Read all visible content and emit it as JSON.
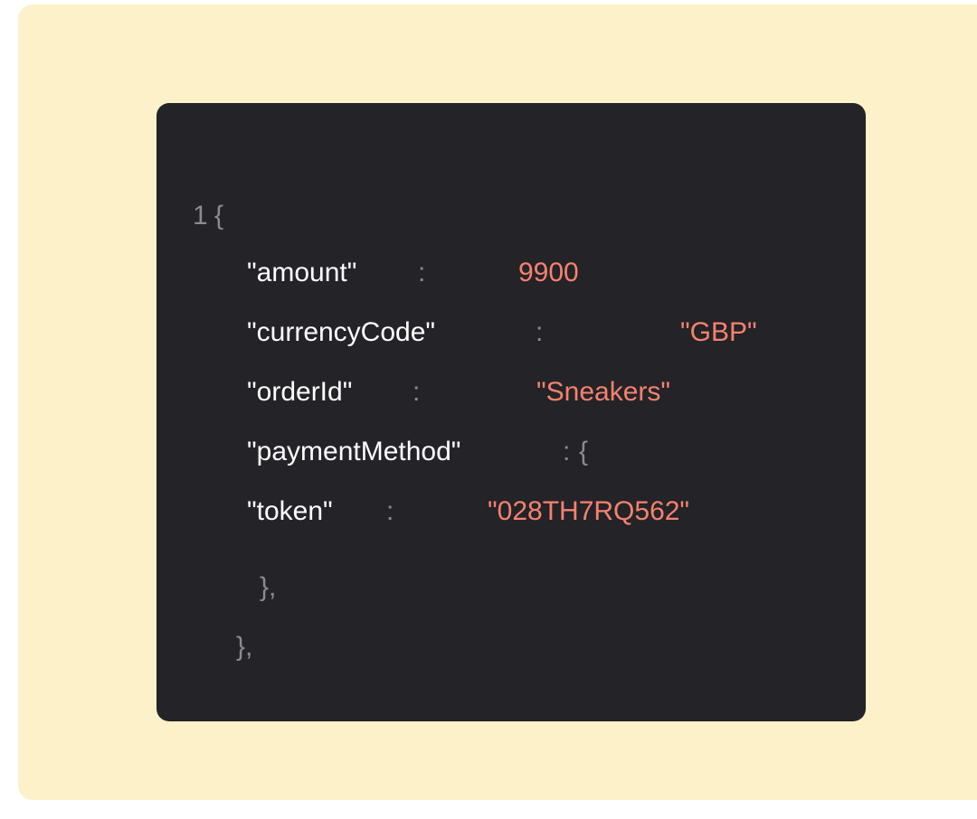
{
  "code": {
    "line_number": "1",
    "open_brace": "{",
    "colon": ":",
    "close_inner": "},",
    "close_outer": "},",
    "rows": [
      {
        "key": "\"amount\"",
        "value": "9900"
      },
      {
        "key": "\"currencyCode\"",
        "value": "\"GBP\""
      },
      {
        "key": "\"orderId\"",
        "value": "\"Sneakers\""
      },
      {
        "key": "\"paymentMethod\"",
        "value": "{"
      },
      {
        "key": "\"token\"",
        "value": "\"028TH7RQ562\""
      }
    ]
  },
  "colors": {
    "page_background": "#fdf1c9",
    "panel_background": "#232328",
    "key_text": "#ffffff",
    "punctuation": "#8a8a8f",
    "value_text": "#f5826e"
  }
}
